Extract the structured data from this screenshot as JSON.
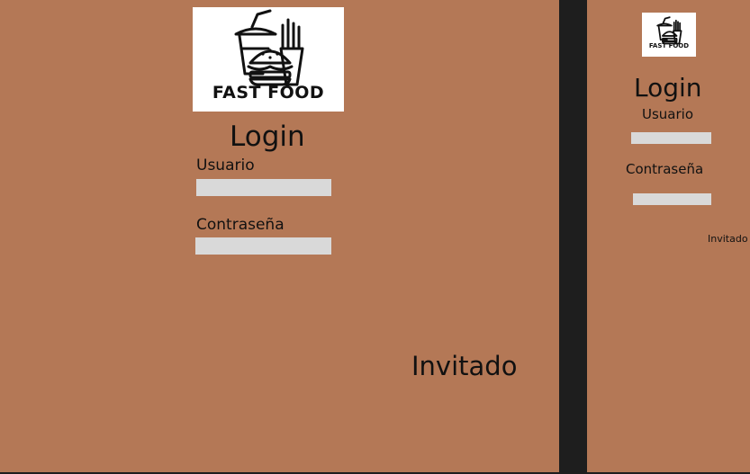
{
  "colors": {
    "background": "#b47856",
    "canvas": "#1e1e1e",
    "input_fill": "#d9d9d9",
    "text": "#111111",
    "logo_background": "#ffffff"
  },
  "screens": [
    {
      "logo": {
        "text": "FAST FOOD",
        "icon": "fast-food-icon"
      },
      "title": "Login",
      "username_label": "Usuario",
      "username_value": "",
      "password_label": "Contraseña",
      "password_value": "",
      "guest_button": "Invitado"
    },
    {
      "logo": {
        "text": "FAST FOOD",
        "icon": "fast-food-icon"
      },
      "title": "Login",
      "username_label": "Usuario",
      "username_value": "",
      "password_label": "Contraseña",
      "password_value": "",
      "guest_button": "Invitado"
    }
  ]
}
